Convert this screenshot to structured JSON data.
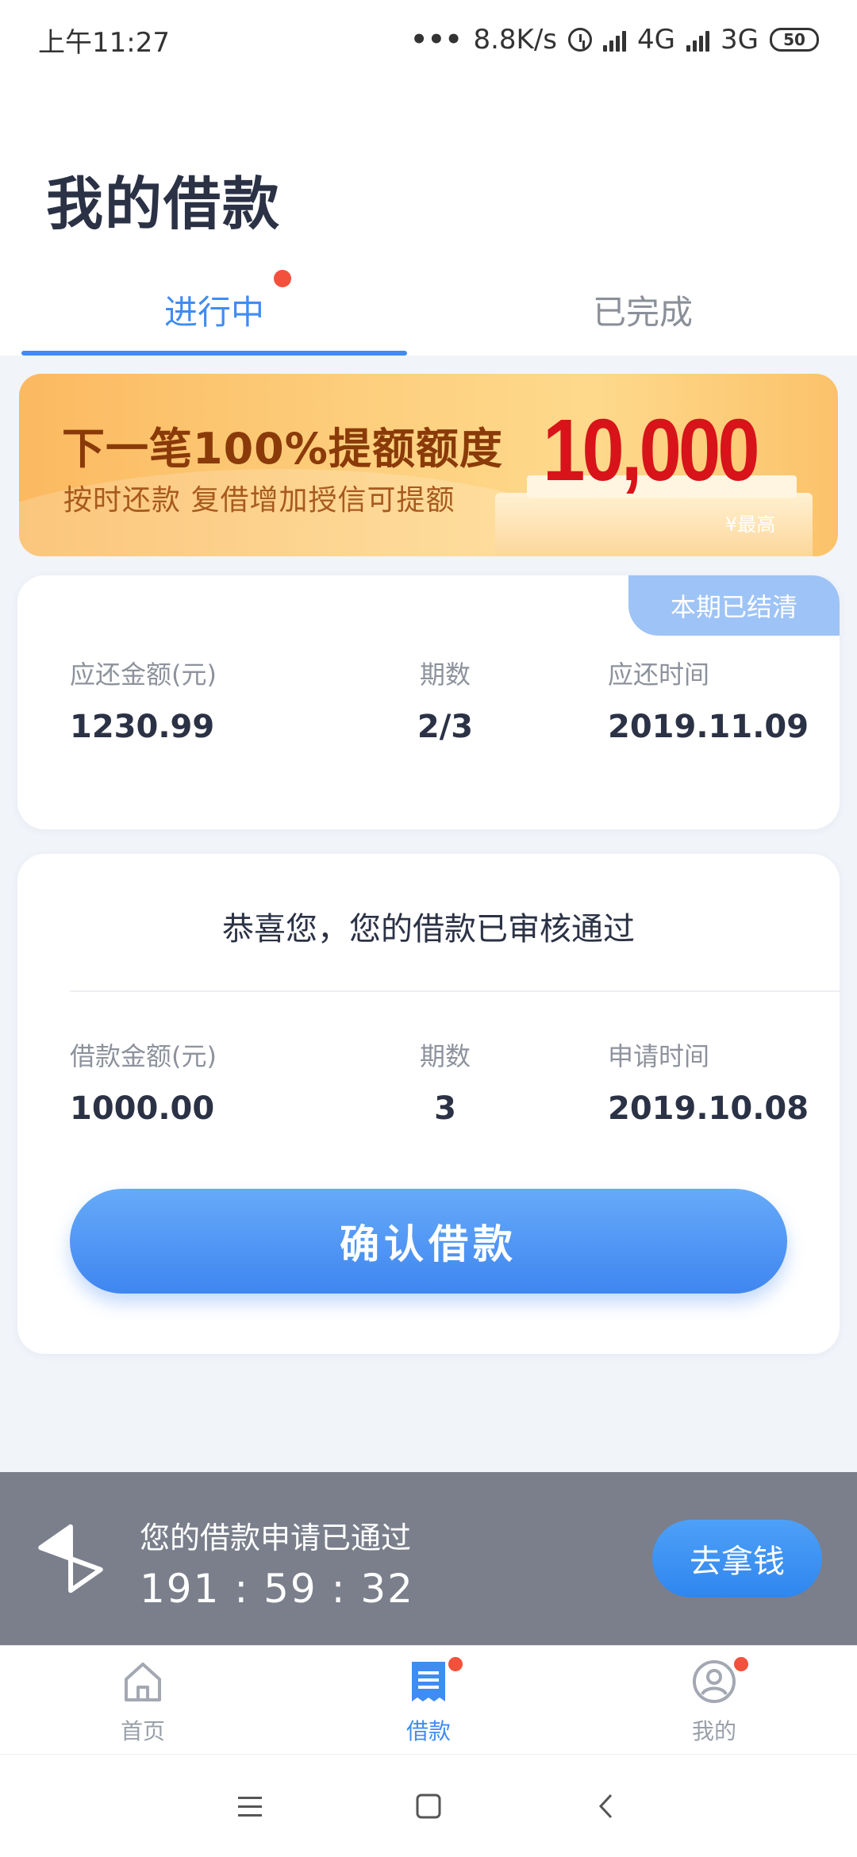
{
  "status_bar": {
    "time": "上午11:27",
    "network_speed": "8.8K/s",
    "network_1": "4G",
    "network_2": "3G",
    "battery": "50"
  },
  "header": {
    "title": "我的借款",
    "tabs": [
      {
        "label": "进行中",
        "active": true,
        "has_dot": true
      },
      {
        "label": "已完成",
        "active": false,
        "has_dot": false
      }
    ]
  },
  "banner": {
    "title": "下一笔100%提额额度",
    "subtitle": "按时还款  复借增加授信可提额",
    "amount": "10,000",
    "amount_note": "¥最高"
  },
  "repayment_card": {
    "badge": "本期已结清",
    "amount_label": "应还金额(元)",
    "amount_value": "1230.99",
    "term_label": "期数",
    "term_value": "2/3",
    "date_label": "应还时间",
    "date_value": "2019.11.09"
  },
  "approval_card": {
    "title": "恭喜您，您的借款已审核通过",
    "amount_label": "借款金额(元)",
    "amount_value": "1000.00",
    "term_label": "期数",
    "term_value": "3",
    "date_label": "申请时间",
    "date_value": "2019.10.08",
    "confirm_label": "确认借款"
  },
  "notice": {
    "icon": "hourglass-icon",
    "text": "您的借款申请已通过",
    "timer": "191 : 59 : 32",
    "button_label": "去拿钱"
  },
  "bottom_nav": {
    "items": [
      {
        "label": "首页",
        "icon": "home-icon",
        "active": false,
        "has_dot": false
      },
      {
        "label": "借款",
        "icon": "loan-icon",
        "active": true,
        "has_dot": true
      },
      {
        "label": "我的",
        "icon": "profile-icon",
        "active": false,
        "has_dot": true
      }
    ]
  },
  "colors": {
    "accent": "#3f8cf2",
    "notice_bg": "#7a7f8b",
    "badge_bg": "#9ec3f6",
    "dot": "#f2513b",
    "banner_amount": "#d8131a"
  }
}
